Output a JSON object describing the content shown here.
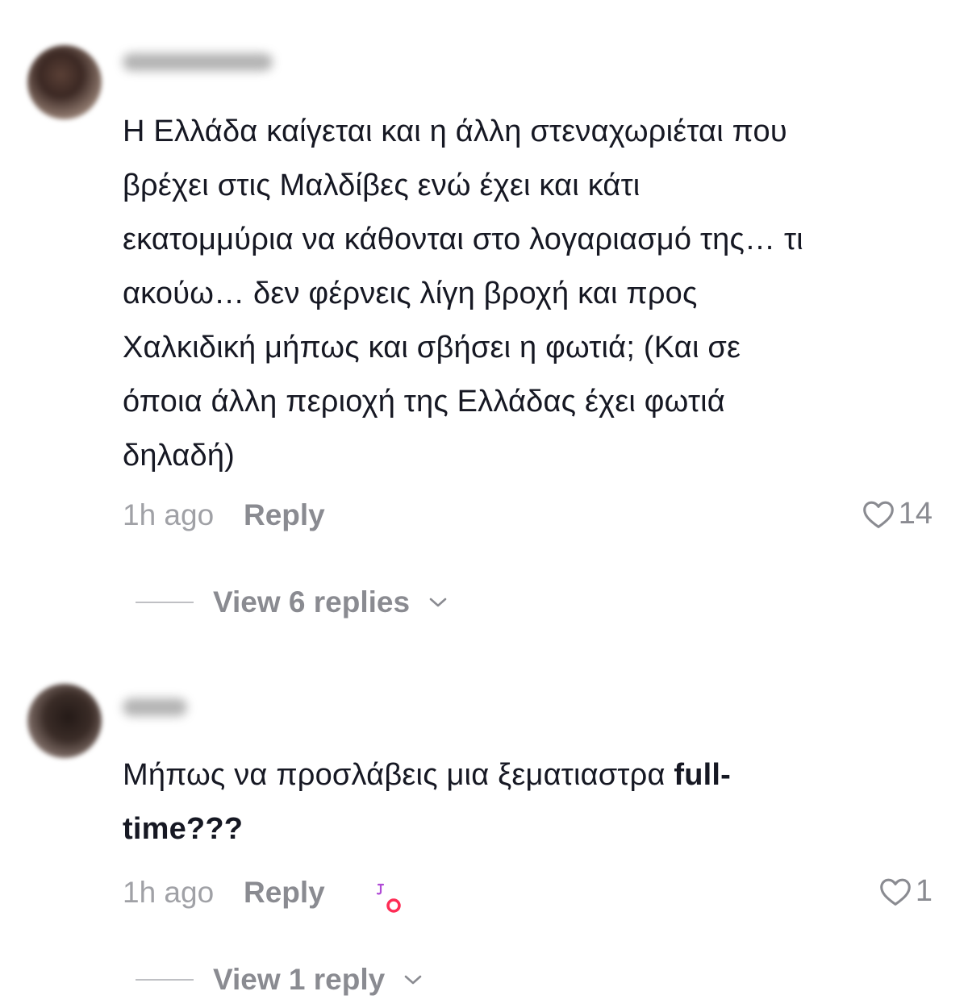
{
  "comments": [
    {
      "text": "Η Ελλάδα καίγεται και η άλλη στεναχωριέται που βρέχει στις Μαλδίβες ενώ έχει και κάτι εκατομμύρια να κάθονται στο λογαριασμό της… τι ακούω… δεν φέρνεις λίγη βροχή και προς Χαλκιδική μήπως και σβήσει η φωτιά; (Και σε όποια άλλη περιοχή της Ελλάδας έχει φωτιά δηλαδή)",
      "lines": [
        "Η Ελλάδα καίγεται και η άλλη στεναχωριέται που",
        "βρέχει στις Μαλδίβες ενώ έχει και κάτι",
        "εκατομμύρια να κάθονται στο λογαριασμό της… τι",
        "ακούω… δεν φέρνεις λίγη βροχή και προς",
        "Χαλκιδική μήπως και σβήσει η φωτιά; (Και σε",
        "όποια άλλη περιοχή της Ελλάδας έχει φωτιά",
        "δηλαδή)"
      ],
      "time": "1h ago",
      "reply_label": "Reply",
      "like_count": "14",
      "view_replies_label": "View 6 replies"
    },
    {
      "text_regular": "Μήπως να προσλάβεις μια ξεματιαστρα ",
      "text_bold_1": "full-",
      "text_bold_2": "time???",
      "time": "1h ago",
      "reply_label": "Reply",
      "like_count": "1",
      "view_replies_label": "View 1 reply"
    }
  ],
  "icons": {
    "like": "heart-outline-icon",
    "expand": "chevron-down-icon",
    "creator_liked": "creator-liked-badge-icon"
  },
  "colors": {
    "text": "#161823",
    "muted": "#8a8b91",
    "badge_pink": "#fe2c55",
    "badge_purple": "#b04bd6"
  }
}
